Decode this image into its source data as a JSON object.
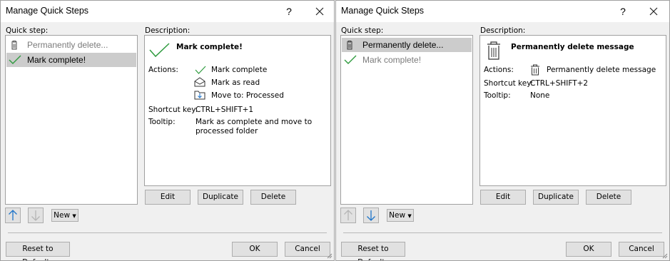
{
  "dialogs": [
    {
      "title": "Manage Quick Steps",
      "help": "?",
      "quick_step_label": "Quick step:",
      "description_label": "Description:",
      "list": [
        {
          "label": "Permanently delete...",
          "icon": "trash-icon",
          "selected": false
        },
        {
          "label": "Mark complete!",
          "icon": "checkmark-icon",
          "selected": true
        }
      ],
      "description": {
        "name": "Mark complete!",
        "actions_label": "Actions:",
        "actions": [
          {
            "icon": "checkmark-icon",
            "text": "Mark complete"
          },
          {
            "icon": "envelope-open-icon",
            "text": "Mark as read"
          },
          {
            "icon": "move-to-folder-icon",
            "text": "Move to: Processed"
          }
        ],
        "shortcut_label": "Shortcut key:",
        "shortcut_value": "CTRL+SHIFT+1",
        "tooltip_label": "Tooltip:",
        "tooltip_value_line1": "Mark as complete and move to",
        "tooltip_value_line2": "processed folder"
      },
      "buttons": {
        "edit": "Edit",
        "duplicate": "Duplicate",
        "delete": "Delete",
        "new": "New",
        "reset": "Reset to Defaults",
        "ok": "OK",
        "cancel": "Cancel"
      },
      "move_up_enabled": true,
      "move_down_enabled": false
    },
    {
      "title": "Manage Quick Steps",
      "help": "?",
      "quick_step_label": "Quick step:",
      "description_label": "Description:",
      "list": [
        {
          "label": "Permanently delete...",
          "icon": "trash-icon",
          "selected": true
        },
        {
          "label": "Mark complete!",
          "icon": "checkmark-icon",
          "selected": false
        }
      ],
      "description": {
        "name": "Permanently delete message",
        "actions_label": "Actions:",
        "actions": [
          {
            "icon": "trash-icon",
            "text": "Permanently delete message"
          }
        ],
        "shortcut_label": "Shortcut key:",
        "shortcut_value": "CTRL+SHIFT+2",
        "tooltip_label": "Tooltip:",
        "tooltip_value_line1": "None",
        "tooltip_value_line2": ""
      },
      "buttons": {
        "edit": "Edit",
        "duplicate": "Duplicate",
        "delete": "Delete",
        "new": "New",
        "reset": "Reset to Defaults",
        "ok": "OK",
        "cancel": "Cancel"
      },
      "move_up_enabled": false,
      "move_down_enabled": true
    }
  ],
  "colors": {
    "accent_blue": "#1e74c9",
    "check_green": "#2e9b3e",
    "selection": "#cccccc",
    "dialog_bg": "#f0f0f0"
  }
}
